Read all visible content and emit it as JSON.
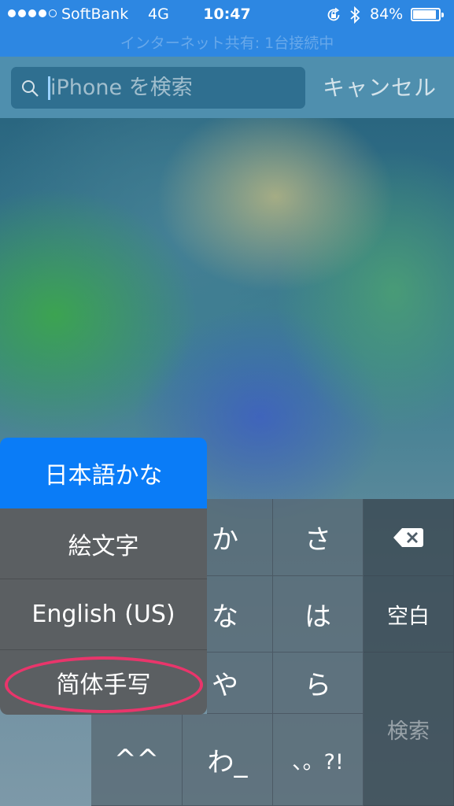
{
  "status_bar": {
    "signal_dots": [
      true,
      true,
      true,
      true,
      false
    ],
    "carrier": "SoftBank",
    "network": "4G",
    "time": "10:47",
    "battery_percent": "84%",
    "battery_level": 0.84,
    "hotspot_banner": "インターネット共有: 1台接続中"
  },
  "search": {
    "placeholder": "iPhone を検索",
    "value": "",
    "cancel_label": "キャンセル"
  },
  "input_menu": {
    "items": [
      {
        "label": "日本語かな",
        "selected": true
      },
      {
        "label": "絵文字",
        "selected": false
      },
      {
        "label": "English (US)",
        "selected": false
      },
      {
        "label": "简体手写",
        "selected": false,
        "highlighted": true
      }
    ]
  },
  "keyboard": {
    "keys_row1": [
      "か",
      "さ"
    ],
    "keys_row2": [
      "な",
      "は"
    ],
    "keys_row3": [
      "や",
      "ら"
    ],
    "keys_row4": [
      "^^",
      "わ_",
      "、。?!"
    ],
    "delete_icon": "backspace-icon",
    "space_label": "空白",
    "search_label": "検索"
  },
  "colors": {
    "status_bar": "#2d87e2",
    "selected_menu": "#0a7cf7",
    "highlight_ring": "#e9356b"
  }
}
